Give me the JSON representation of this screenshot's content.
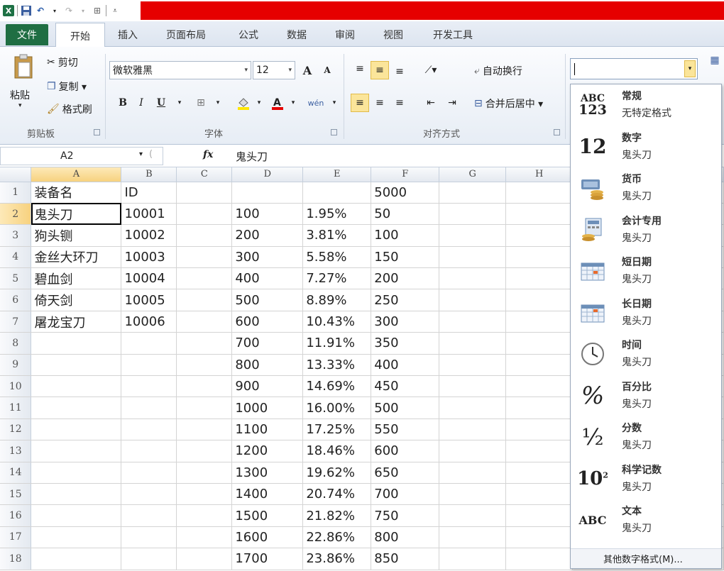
{
  "tabs": {
    "file": "文件",
    "items": [
      "开始",
      "插入",
      "页面布局",
      "公式",
      "数据",
      "审阅",
      "视图",
      "开发工具"
    ]
  },
  "ribbon": {
    "clipboard": {
      "paste": "粘贴",
      "cut": "剪切",
      "copy": "复制 ▾",
      "format_painter": "格式刷",
      "group": "剪贴板"
    },
    "font": {
      "name": "微软雅黑",
      "size": "12",
      "bold": "B",
      "italic": "I",
      "underline": "U",
      "group": "字体",
      "grow": "A",
      "shrink": "A",
      "wen": "wén"
    },
    "align": {
      "wrap": "自动换行",
      "merge": "合并后居中 ▾",
      "group": "对齐方式"
    }
  },
  "formula_bar": {
    "cell_ref": "A2",
    "fx": "fx",
    "value": "鬼头刀"
  },
  "sheet": {
    "columns": [
      "A",
      "B",
      "C",
      "D",
      "E",
      "F",
      "G",
      "H"
    ],
    "rows": [
      [
        "1",
        "装备名",
        "ID",
        "",
        "",
        "",
        "5000",
        "",
        ""
      ],
      [
        "2",
        "鬼头刀",
        "10001",
        "",
        "100",
        "1.95%",
        "50",
        "",
        ""
      ],
      [
        "3",
        "狗头铡",
        "10002",
        "",
        "200",
        "3.81%",
        "100",
        "",
        ""
      ],
      [
        "4",
        "金丝大环刀",
        "10003",
        "",
        "300",
        "5.58%",
        "150",
        "",
        ""
      ],
      [
        "5",
        "碧血剑",
        "10004",
        "",
        "400",
        "7.27%",
        "200",
        "",
        ""
      ],
      [
        "6",
        "倚天剑",
        "10005",
        "",
        "500",
        "8.89%",
        "250",
        "",
        ""
      ],
      [
        "7",
        "屠龙宝刀",
        "10006",
        "",
        "600",
        "10.43%",
        "300",
        "",
        ""
      ],
      [
        "8",
        "",
        "",
        "",
        "700",
        "11.91%",
        "350",
        "",
        ""
      ],
      [
        "9",
        "",
        "",
        "",
        "800",
        "13.33%",
        "400",
        "",
        ""
      ],
      [
        "10",
        "",
        "",
        "",
        "900",
        "14.69%",
        "450",
        "",
        ""
      ],
      [
        "11",
        "",
        "",
        "",
        "1000",
        "16.00%",
        "500",
        "",
        ""
      ],
      [
        "12",
        "",
        "",
        "",
        "1100",
        "17.25%",
        "550",
        "",
        ""
      ],
      [
        "13",
        "",
        "",
        "",
        "1200",
        "18.46%",
        "600",
        "",
        ""
      ],
      [
        "14",
        "",
        "",
        "",
        "1300",
        "19.62%",
        "650",
        "",
        ""
      ],
      [
        "15",
        "",
        "",
        "",
        "1400",
        "20.74%",
        "700",
        "",
        ""
      ],
      [
        "16",
        "",
        "",
        "",
        "1500",
        "21.82%",
        "750",
        "",
        ""
      ],
      [
        "17",
        "",
        "",
        "",
        "1600",
        "22.86%",
        "800",
        "",
        ""
      ],
      [
        "18",
        "",
        "",
        "",
        "1700",
        "23.86%",
        "850",
        "",
        ""
      ]
    ]
  },
  "number_format_dropdown": {
    "items": [
      {
        "icon": "abc-123-icon",
        "glyph": "ABC 123",
        "name": "常规",
        "sample": "无特定格式"
      },
      {
        "icon": "number-12-icon",
        "glyph": "12",
        "name": "数字",
        "sample": "鬼头刀"
      },
      {
        "icon": "currency-icon",
        "glyph": "",
        "name": "货币",
        "sample": "鬼头刀"
      },
      {
        "icon": "accounting-icon",
        "glyph": "",
        "name": "会计专用",
        "sample": "鬼头刀"
      },
      {
        "icon": "short-date-icon",
        "glyph": "",
        "name": "短日期",
        "sample": "鬼头刀"
      },
      {
        "icon": "long-date-icon",
        "glyph": "",
        "name": "长日期",
        "sample": "鬼头刀"
      },
      {
        "icon": "clock-icon",
        "glyph": "",
        "name": "时间",
        "sample": "鬼头刀"
      },
      {
        "icon": "percent-icon",
        "glyph": "%",
        "name": "百分比",
        "sample": "鬼头刀"
      },
      {
        "icon": "fraction-icon",
        "glyph": "½",
        "name": "分数",
        "sample": "鬼头刀"
      },
      {
        "icon": "scientific-icon",
        "glyph": "10²",
        "name": "科学记数",
        "sample": "鬼头刀"
      },
      {
        "icon": "text-abc-icon",
        "glyph": "ABC",
        "name": "文本",
        "sample": "鬼头刀"
      }
    ],
    "more": "其他数字格式(M)..."
  },
  "colors": {
    "title_red": "#e60000",
    "file_tab": "#1f6e43",
    "highlight": "#fbe59a"
  }
}
